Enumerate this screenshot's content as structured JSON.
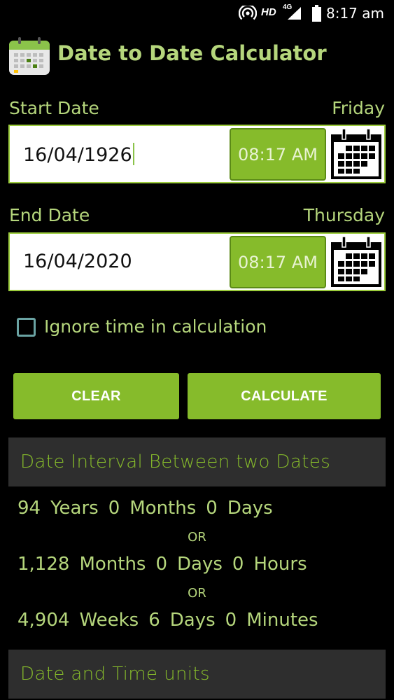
{
  "status_bar": {
    "hd": "HD",
    "network": "4G",
    "time": "8:17 am"
  },
  "app": {
    "title": "Date to Date Calculator",
    "logo_icon": "calendar-logo-icon"
  },
  "start": {
    "label": "Start Date",
    "weekday": "Friday",
    "date": "16/04/1926",
    "time": "08:17 AM"
  },
  "end": {
    "label": "End Date",
    "weekday": "Thursday",
    "date": "16/04/2020",
    "time": "08:17 AM"
  },
  "options": {
    "ignore_time_label": "Ignore time in calculation",
    "ignore_time_checked": false
  },
  "buttons": {
    "clear": "CLEAR",
    "calculate": "CALCULATE"
  },
  "interval": {
    "header": "Date Interval Between two Dates",
    "or_label": "OR",
    "line1": {
      "years": "94",
      "years_label": "Years",
      "months": "0",
      "months_label": "Months",
      "days": "0",
      "days_label": "Days"
    },
    "line2": {
      "months": "1,128",
      "months_label": "Months",
      "days": "0",
      "days_label": "Days",
      "hours": "0",
      "hours_label": "Hours"
    },
    "line3": {
      "weeks": "4,904",
      "weeks_label": "Weeks",
      "days": "6",
      "days_label": "Days",
      "minutes": "0",
      "minutes_label": "Minutes"
    }
  },
  "units": {
    "header": "Date and Time units"
  },
  "colors": {
    "accent": "#86bb2b",
    "text_green": "#b5d67c",
    "background": "#000000",
    "section_bg": "#2e2e2e"
  }
}
